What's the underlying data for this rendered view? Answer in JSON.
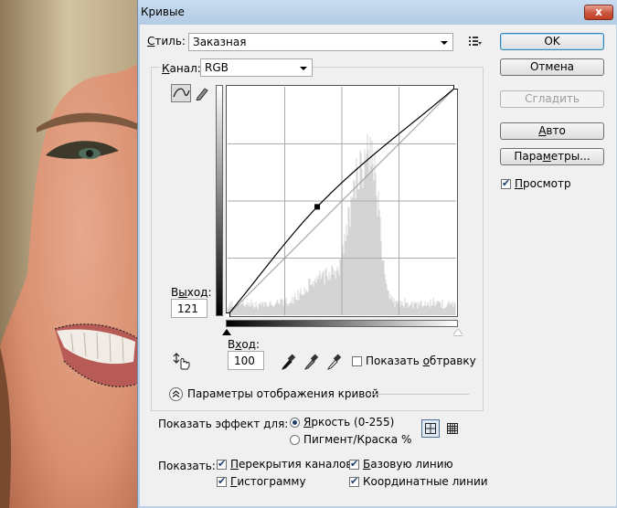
{
  "window": {
    "title": "Кривые",
    "close_glyph": "x"
  },
  "preset": {
    "label_pre": "",
    "label_u": "С",
    "label_post": "тиль:",
    "value": "Заказная"
  },
  "channel": {
    "label_pre": "",
    "label_u": "К",
    "label_post": "анал:",
    "value": "RGB"
  },
  "buttons": {
    "ok": "OK",
    "cancel": "Отмена",
    "smooth": "Сгладить",
    "auto_u": "А",
    "auto_post": "вто",
    "options_pre": "Пара",
    "options_u": "м",
    "options_post": "етры..."
  },
  "preview": {
    "label_pre": "",
    "label_u": "П",
    "label_post": "росмотр",
    "checked": true
  },
  "output": {
    "label_pre": "В",
    "label_u": "ы",
    "label_post": "ход:",
    "value": "121"
  },
  "input": {
    "label_pre": "В",
    "label_u": "х",
    "label_post": "од:",
    "value": "100"
  },
  "clipping": {
    "label_pre": "Показать ",
    "label_u": "о",
    "label_post": "бтравку",
    "checked": false
  },
  "display_options": {
    "label": "Параметры отображения кривой"
  },
  "show_amount": {
    "label": "Показать эффект для:",
    "light_u": "Я",
    "light_post": "ркость (0-255)",
    "pigment": "Пигмент/Краска %",
    "selected": "light"
  },
  "show": {
    "label": "Показать:",
    "channel_overlays_u": "П",
    "channel_overlays_post": "ерекрытия каналов",
    "baseline_u": "Б",
    "baseline_post": "азовую линию",
    "histogram_u": "Г",
    "histogram_post": "истограмму",
    "intersection_u": "",
    "intersection_post": "Координатные линии",
    "checked": [
      true,
      true,
      true,
      true
    ]
  },
  "curve": {
    "points": [
      [
        0,
        0
      ],
      [
        100,
        121
      ],
      [
        255,
        255
      ]
    ],
    "selected_point": 1,
    "grid_divisions": 4
  },
  "icons": {
    "curve_tool": "curve-point-icon",
    "pencil_tool": "pencil-icon",
    "target_adjust": "hand-target-icon",
    "eyedropper_black": "black-eyedropper-icon",
    "eyedropper_gray": "gray-eyedropper-icon",
    "eyedropper_white": "white-eyedropper-icon",
    "preset_menu": "preset-options-icon",
    "grid_simple": "grid-4x4-icon",
    "grid_detailed": "grid-10x10-icon",
    "expand": "chevron-up-circle-icon"
  },
  "colors": {
    "accent": "#3c7fb1",
    "window_frame": "#b9d1ea",
    "close": "#c23f24"
  }
}
